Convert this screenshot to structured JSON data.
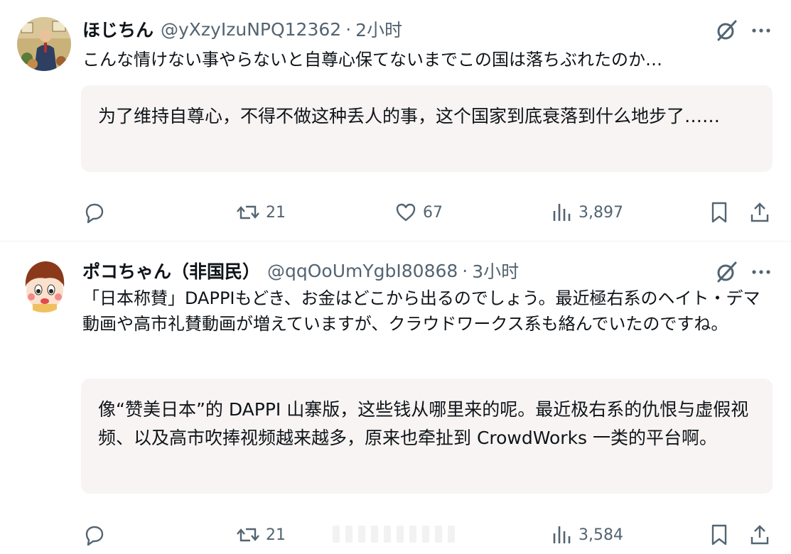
{
  "posts": [
    {
      "user": {
        "display_name": "ほじちん",
        "handle": "@yXzyIzuNPQ12362",
        "time": "2小时"
      },
      "separator": "·",
      "original_text": "こんな情けない事やらないと自尊心保てないまでこの国は落ちぶれたのか…",
      "translation": "为了维持自尊心，不得不做这种丢人的事，这个国家到底衰落到什么地步了……",
      "stats": {
        "reposts": "21",
        "likes": "67",
        "views": "3,897"
      }
    },
    {
      "user": {
        "display_name": "ポコちゃん（非国民）",
        "handle": "@qqOoUmYgbI80868",
        "time": "3小时"
      },
      "separator": "·",
      "original_text": "「日本称賛」DAPPIもどき、お金はどこから出るのでしょう。最近極右系のヘイト・デマ動画や高市礼賛動画が増えていますが、クラウドワークス系も絡んでいたのですね。",
      "translation": "像“赞美日本”的 DAPPI 山寨版，这些钱从哪里来的呢。最近极右系的仇恨与虚假视频、以及高市吹捧视频越来越多，原来也牵扯到 CrowdWorks 一类的平台啊。",
      "stats": {
        "reposts": "21",
        "views": "3,584"
      }
    }
  ],
  "icons": [
    "reply-icon",
    "repost-icon",
    "like-icon",
    "views-icon",
    "bookmark-icon",
    "share-icon",
    "grok-icon",
    "more-icon"
  ],
  "colors": {
    "text": "#0f1419",
    "secondary": "#536471",
    "translation_bg": "#f7f4f3"
  }
}
